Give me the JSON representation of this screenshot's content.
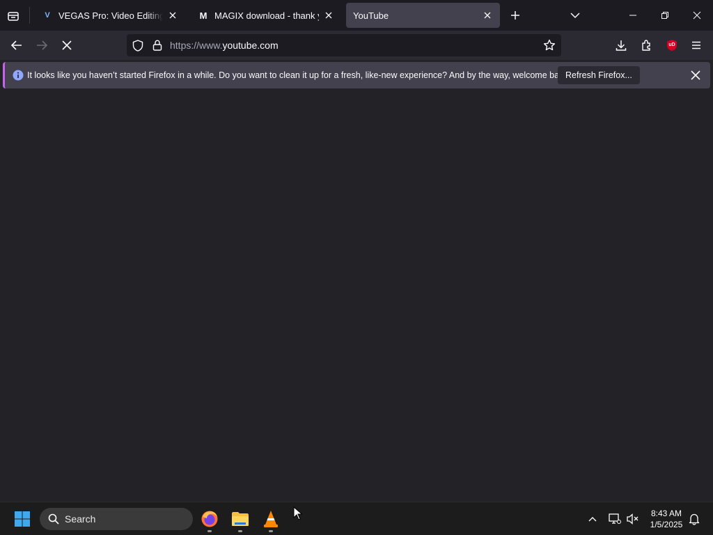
{
  "browser": {
    "tabs": [
      {
        "title": "VEGAS Pro: Video Editing Software",
        "favicon_letter": "V",
        "active": false
      },
      {
        "title": "MAGIX download - thank you",
        "favicon_letter": "M",
        "active": false
      },
      {
        "title": "YouTube",
        "favicon_letter": "",
        "active": true
      }
    ],
    "url": {
      "prefix": "https://www.",
      "domain": "youtube.com"
    },
    "extension_badge": "uD"
  },
  "notification": {
    "message": "It looks like you haven’t started Firefox in a while. Do you want to clean it up for a fresh, like-new experience? And by the way, welcome back!",
    "button_label": "Refresh Firefox..."
  },
  "taskbar": {
    "search_placeholder": "Search",
    "time": "8:43 AM",
    "date": "1/5/2025"
  },
  "colors": {
    "accent": "#c363f0",
    "info_icon": "#8fa7ff",
    "addon_red": "#d70022"
  },
  "icons": [
    "firefox-view-icon",
    "close-icon",
    "new-tab-icon",
    "list-all-tabs-icon",
    "minimize-icon",
    "restore-icon",
    "back-icon",
    "forward-icon",
    "stop-icon",
    "shield-icon",
    "lock-icon",
    "star-icon",
    "download-icon",
    "extensions-icon",
    "menu-icon",
    "info-icon",
    "windows-start-icon",
    "search-icon",
    "firefox-icon",
    "file-explorer-icon",
    "vlc-icon",
    "chevron-up-icon",
    "network-icon",
    "volume-muted-icon",
    "notification-bell-icon",
    "mouse-cursor-icon"
  ]
}
